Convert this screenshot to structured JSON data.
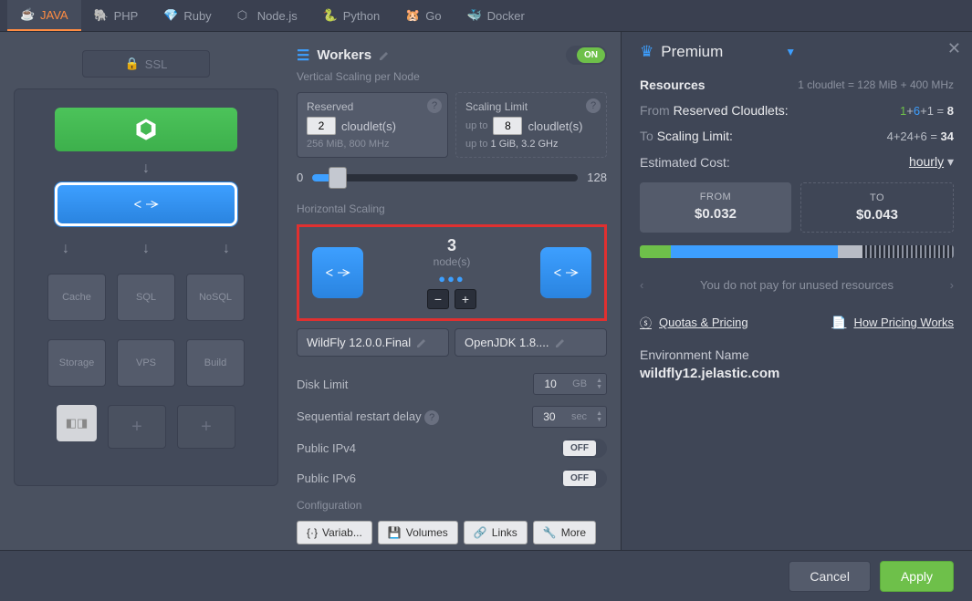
{
  "tabs": [
    "JAVA",
    "PHP",
    "Ruby",
    "Node.js",
    "Python",
    "Go",
    "Docker"
  ],
  "ssl_label": "SSL",
  "section": {
    "title": "Workers",
    "toggle": "ON"
  },
  "vertical_label": "Vertical Scaling per Node",
  "reserved": {
    "title": "Reserved",
    "value": "2",
    "unit": "cloudlet(s)",
    "sub": "256 MiB, 800 MHz"
  },
  "scaling": {
    "title": "Scaling Limit",
    "prefix": "up to",
    "value": "8",
    "unit": "cloudlet(s)",
    "sub_prefix": "up to ",
    "sub": "1 GiB, 3.2 GHz"
  },
  "slider": {
    "min": "0",
    "max": "128"
  },
  "horizontal_label": "Horizontal Scaling",
  "hs": {
    "count": "3",
    "label": "node(s)"
  },
  "versions": {
    "wildfly": "WildFly 12.0.0.Final",
    "jdk": "OpenJDK 1.8...."
  },
  "disk": {
    "label": "Disk Limit",
    "value": "10",
    "unit": "GB"
  },
  "restart": {
    "label": "Sequential restart delay",
    "value": "30",
    "unit": "sec"
  },
  "ipv4": {
    "label": "Public IPv4",
    "state": "OFF"
  },
  "ipv6": {
    "label": "Public IPv6",
    "state": "OFF"
  },
  "config_label": "Configuration",
  "cfg": {
    "variables": "Variab...",
    "volumes": "Volumes",
    "links": "Links",
    "more": "More"
  },
  "grid": {
    "cache": "Cache",
    "sql": "SQL",
    "nosql": "NoSQL",
    "storage": "Storage",
    "vps": "VPS",
    "build": "Build"
  },
  "premium": {
    "title": "Premium",
    "resources": "Resources",
    "cloudlet_eq": "1 cloudlet = 128 MiB + 400 MHz",
    "from_label": "From",
    "reserved_label": "Reserved Cloudlets:",
    "from_calc": {
      "a": "1",
      "b": "6",
      "c": "1",
      "total": "8"
    },
    "to_label": "To",
    "sl_label": "Scaling Limit:",
    "to_calc": {
      "a": "4",
      "b": "24",
      "c": "6",
      "total": "34"
    },
    "est_label": "Estimated Cost:",
    "period": "hourly",
    "from_box": {
      "label": "FROM",
      "value": "$0.032"
    },
    "to_box": {
      "label": "TO",
      "value": "$0.043"
    },
    "info_text": "You do not pay for unused resources",
    "quotas": "Quotas & Pricing",
    "how": "How Pricing Works",
    "env_label": "Environment Name",
    "env_name": "wildfly12.jelastic.com"
  },
  "buttons": {
    "cancel": "Cancel",
    "apply": "Apply"
  }
}
